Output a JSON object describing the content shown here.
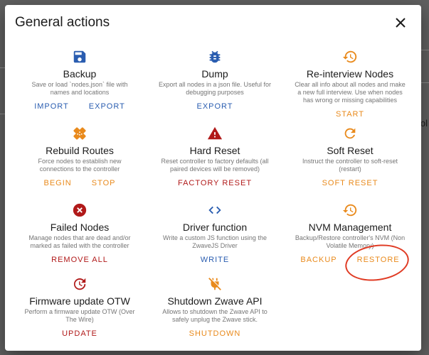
{
  "dialog": {
    "title": "General actions",
    "close_icon": "close-icon"
  },
  "background": {
    "partial_text": "ol"
  },
  "colors": {
    "blue": "#2a5db0",
    "orange": "#e98a1c",
    "red": "#b11a1a",
    "annotation": "#e03b24"
  },
  "actions": [
    {
      "id": "backup",
      "icon": "save-icon",
      "color": "blue",
      "title": "Backup",
      "desc": "Save or load `nodes.json` file with names and locations",
      "buttons": [
        "IMPORT",
        "EXPORT"
      ]
    },
    {
      "id": "dump",
      "icon": "bug-icon",
      "color": "blue",
      "title": "Dump",
      "desc": "Export all nodes in a json file. Useful for debugging purposes",
      "buttons": [
        "EXPORT"
      ]
    },
    {
      "id": "reinterview",
      "icon": "history-icon",
      "color": "orange",
      "title": "Re-interview Nodes",
      "desc": "Clear all info about all nodes and make a new full interview. Use when nodes has wrong or missing capabilities",
      "buttons": [
        "START"
      ]
    },
    {
      "id": "rebuild",
      "icon": "healing-icon",
      "color": "orange",
      "title": "Rebuild Routes",
      "desc": "Force nodes to establish new connections to the controller",
      "buttons": [
        "BEGIN",
        "STOP"
      ]
    },
    {
      "id": "hardreset",
      "icon": "warning-icon",
      "color": "red",
      "title": "Hard Reset",
      "desc": "Reset controller to factory defaults (all paired devices will be removed)",
      "buttons": [
        "FACTORY RESET"
      ]
    },
    {
      "id": "softreset",
      "icon": "refresh-icon",
      "color": "orange",
      "title": "Soft Reset",
      "desc": "Instruct the controller to soft-reset (restart)",
      "buttons": [
        "SOFT RESET"
      ]
    },
    {
      "id": "failednodes",
      "icon": "error-icon",
      "color": "red",
      "title": "Failed Nodes",
      "desc": "Manage nodes that are dead and/or marked as failed with the controller",
      "buttons": [
        "REMOVE ALL"
      ]
    },
    {
      "id": "driverfunction",
      "icon": "code-icon",
      "color": "blue",
      "title": "Driver function",
      "desc": "Write a custom JS function using the ZwaveJS Driver",
      "buttons": [
        "WRITE"
      ]
    },
    {
      "id": "nvm",
      "icon": "restore-icon",
      "color": "orange",
      "title": "NVM Management",
      "desc": "Backup/Restore controller's NVM (Non Volatile Memory)",
      "buttons": [
        "BACKUP",
        "RESTORE"
      ]
    },
    {
      "id": "firmware",
      "icon": "update-icon",
      "color": "red",
      "title": "Firmware update OTW",
      "desc": "Perform a firmware update OTW (Over The Wire)",
      "buttons": [
        "UPDATE"
      ]
    },
    {
      "id": "shutdown",
      "icon": "power-plug-off-icon",
      "color": "orange",
      "title": "Shutdown Zwave API",
      "desc": "Allows to shutdown the Zwave API to safely unplug the Zwave stick.",
      "buttons": [
        "SHUTDOWN"
      ]
    }
  ]
}
